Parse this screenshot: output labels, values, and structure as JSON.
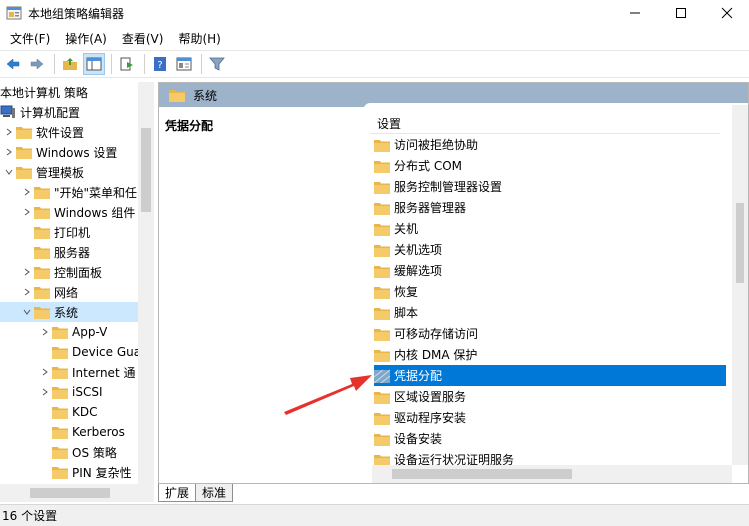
{
  "window": {
    "title": "本地组策略编辑器",
    "minimize_icon": "minimize-icon",
    "maximize_icon": "maximize-icon",
    "close_icon": "close-icon"
  },
  "menu": [
    "文件(F)",
    "操作(A)",
    "查看(V)",
    "帮助(H)"
  ],
  "toolbar": {
    "icons": [
      "back-icon",
      "forward-icon",
      "up-folder-icon",
      "show-hide-tree-icon",
      "export-list-icon",
      "help-icon",
      "properties-icon",
      "filter-icon"
    ]
  },
  "tree": {
    "items": [
      {
        "label": "本地计算机 策略",
        "level": 0,
        "chevron": "none"
      },
      {
        "label": "计算机配置",
        "level": 0,
        "chevron": "none",
        "icon": "computer-icon"
      },
      {
        "label": "软件设置",
        "level": 1,
        "chevron": "right"
      },
      {
        "label": "Windows 设置",
        "level": 1,
        "chevron": "right"
      },
      {
        "label": "管理模板",
        "level": 1,
        "chevron": "down"
      },
      {
        "label": "\"开始\"菜单和任",
        "level": 2,
        "chevron": "right"
      },
      {
        "label": "Windows 组件",
        "level": 2,
        "chevron": "right"
      },
      {
        "label": "打印机",
        "level": 2,
        "chevron": "none"
      },
      {
        "label": "服务器",
        "level": 2,
        "chevron": "none"
      },
      {
        "label": "控制面板",
        "level": 2,
        "chevron": "right"
      },
      {
        "label": "网络",
        "level": 2,
        "chevron": "right"
      },
      {
        "label": "系统",
        "level": 2,
        "chevron": "down",
        "selected": true
      },
      {
        "label": "App-V",
        "level": 3,
        "chevron": "right"
      },
      {
        "label": "Device Gua",
        "level": 3,
        "chevron": "none"
      },
      {
        "label": "Internet 通",
        "level": 3,
        "chevron": "right"
      },
      {
        "label": "iSCSI",
        "level": 3,
        "chevron": "right"
      },
      {
        "label": "KDC",
        "level": 3,
        "chevron": "none"
      },
      {
        "label": "Kerberos",
        "level": 3,
        "chevron": "none"
      },
      {
        "label": "OS 策略",
        "level": 3,
        "chevron": "none"
      },
      {
        "label": "PIN 复杂性",
        "level": 3,
        "chevron": "none"
      }
    ]
  },
  "right": {
    "header_title": "系统",
    "description_title": "凭据分配",
    "list_header": "设置",
    "items": [
      {
        "label": "访问被拒绝协助"
      },
      {
        "label": "分布式 COM"
      },
      {
        "label": "服务控制管理器设置"
      },
      {
        "label": "服务器管理器"
      },
      {
        "label": "关机"
      },
      {
        "label": "关机选项"
      },
      {
        "label": "缓解选项"
      },
      {
        "label": "恢复"
      },
      {
        "label": "脚本"
      },
      {
        "label": "可移动存储访问"
      },
      {
        "label": "内核 DMA 保护"
      },
      {
        "label": "凭据分配",
        "selected": true
      },
      {
        "label": "区域设置服务"
      },
      {
        "label": "驱动程序安装"
      },
      {
        "label": "设备安装"
      },
      {
        "label": "设备运行状况证明服务"
      }
    ]
  },
  "tabs": [
    "扩展",
    "标准"
  ],
  "status": {
    "text": "16 个设置"
  },
  "colors": {
    "selection": "#0078d7",
    "tree_selection": "#cce8ff",
    "header_bar": "#9db3c9",
    "folder": "#e8b64a",
    "annotation_arrow": "#e5322d"
  }
}
